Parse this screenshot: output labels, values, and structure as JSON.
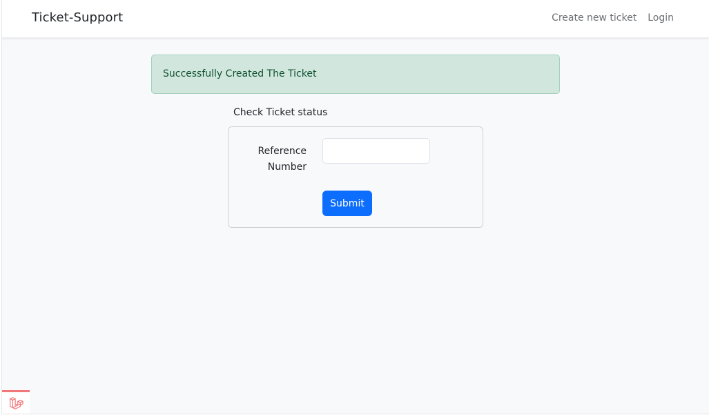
{
  "navbar": {
    "brand": "Ticket-Support",
    "links": [
      {
        "label": "Create new ticket"
      },
      {
        "label": "Login"
      }
    ]
  },
  "alert": {
    "message": "Successfully Created The Ticket",
    "status_color": "#d1e7dd"
  },
  "ticket_form": {
    "title": "Check Ticket status",
    "reference_label": "Reference Number",
    "reference_value": "",
    "submit_label": "Submit",
    "accent_color": "#0d6efd"
  },
  "debugbar": {
    "icon": "laravel-logo-icon",
    "accent_color": "#f2777a"
  }
}
